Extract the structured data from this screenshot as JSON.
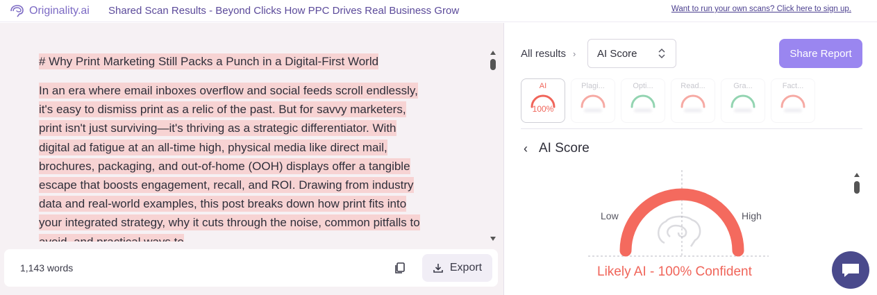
{
  "header": {
    "logo_text": "Originality.ai",
    "title": "Shared Scan Results - Beyond Clicks How PPC Drives Real Business Grow",
    "signup_link": "Want to run your own scans? Click here to sign up."
  },
  "document": {
    "heading": "# Why Print Marketing Still Packs a Punch in a Digital-First World",
    "paragraph": "In an era where email inboxes overflow and social feeds scroll endlessly, it's easy to dismiss print as a relic of the past. But for savvy marketers, print isn't just surviving—it's thriving as a strategic differentiator. With digital ad fatigue at an all-time high, physical media like direct mail, brochures, packaging, and out-of-home (OOH) displays offer a tangible escape that boosts engagement, recall, and ROI. Drawing from industry data and real-world examples, this post breaks down how print fits into your integrated strategy, why it cuts through the noise, common pitfalls to avoid, and practical ways to"
  },
  "footer": {
    "word_count": "1,143 words",
    "export_label": "Export"
  },
  "results": {
    "breadcrumb": "All results",
    "selected_score": "AI Score",
    "share_label": "Share Report",
    "tabs": [
      {
        "label": "AI",
        "value": "100%",
        "active": true,
        "color": "#f0655a"
      },
      {
        "label": "Plagi...",
        "active": false,
        "color": "#f0655a"
      },
      {
        "label": "Opti...",
        "active": false,
        "color": "#3bb273"
      },
      {
        "label": "Read...",
        "active": false,
        "color": "#f0655a"
      },
      {
        "label": "Gra...",
        "active": false,
        "color": "#3bb273"
      },
      {
        "label": "Fact...",
        "active": false,
        "color": "#f0655a"
      }
    ],
    "section_title": "AI Score",
    "gauge": {
      "low_label": "Low",
      "high_label": "High",
      "score_percent": 100,
      "verdict": "Likely AI - 100% Confident",
      "color": "#f46a5e"
    }
  },
  "icons": {
    "logo": "brain-icon",
    "copy": "copy-icon",
    "export": "download-icon",
    "back": "chevron-left-icon",
    "breadcrumb_sep": "chevron-right-icon",
    "select": "chevron-updown-icon",
    "chat": "chat-bubble-icon"
  }
}
